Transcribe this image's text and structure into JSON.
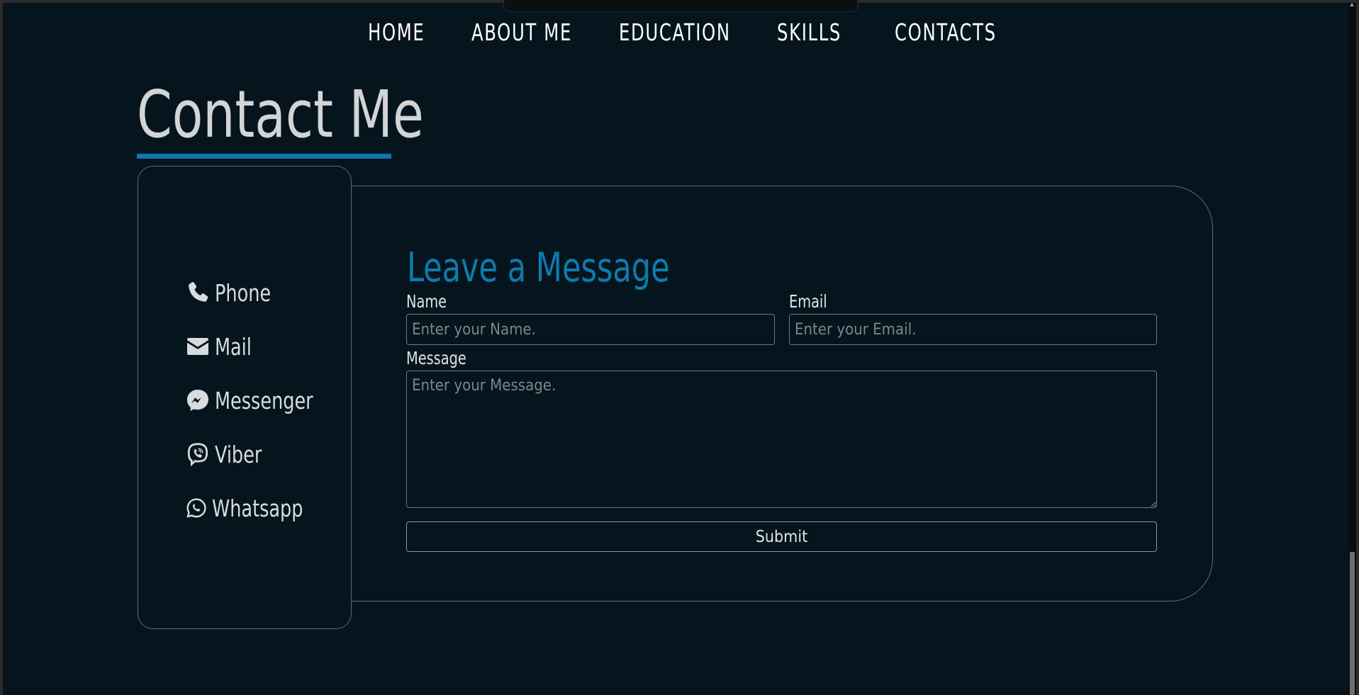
{
  "nav": {
    "items": [
      {
        "label": "HOME"
      },
      {
        "label": "ABOUT ME"
      },
      {
        "label": "EDUCATION"
      },
      {
        "label": "SKILLS"
      },
      {
        "label": "CONTACTS"
      }
    ]
  },
  "page": {
    "title": "Contact Me",
    "accent_color": "#0c78ab",
    "background_color": "#06151d"
  },
  "contacts": {
    "items": [
      {
        "label": "Phone",
        "icon": "phone-icon"
      },
      {
        "label": "Mail",
        "icon": "mail-icon"
      },
      {
        "label": "Messenger",
        "icon": "messenger-icon"
      },
      {
        "label": "Viber",
        "icon": "viber-icon"
      },
      {
        "label": "Whatsapp",
        "icon": "whatsapp-icon"
      }
    ]
  },
  "form": {
    "title": "Leave a Message",
    "name_label": "Name",
    "name_placeholder": "Enter your Name.",
    "email_label": "Email",
    "email_placeholder": "Enter your Email.",
    "message_label": "Message",
    "message_placeholder": "Enter your Message.",
    "submit_label": "Submit"
  }
}
